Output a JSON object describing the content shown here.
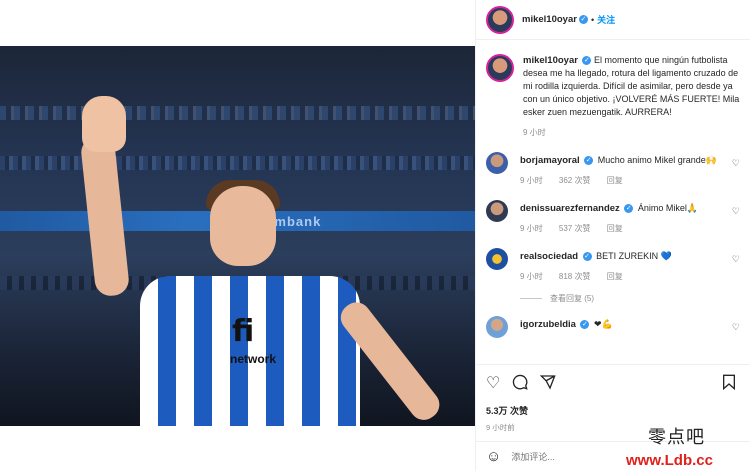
{
  "post": {
    "username": "mikel10oyar",
    "follow_label": "关注",
    "dot": "•",
    "caption": "El momento que ningún futbolista desea me ha llegado, rotura del ligamento cruzado de mi rodilla izquierda. Difícil de asimilar, pero desde ya con un único objetivo. ¡VOLVERÉ MÁS FUERTE! Mila esker zuen mezuengatik. AURRERA!",
    "caption_time": "9 小时",
    "media": {
      "sponsor": "fi",
      "sponsor_sub": "network",
      "ad_text": "Teambank"
    }
  },
  "comments": [
    {
      "username": "borjamayoral",
      "text": "Mucho animo Mikel grande🙌",
      "time": "9 小时",
      "likes": "362 次赞",
      "reply": "回复"
    },
    {
      "username": "denissuarezfernandez",
      "text": "Ánimo Mikel🙏",
      "time": "9 小时",
      "likes": "537 次赞",
      "reply": "回复"
    },
    {
      "username": "realsociedad",
      "text": "BETI ZUREKIN 💙",
      "time": "9 小时",
      "likes": "818 次赞",
      "reply": "回复",
      "view_replies": "查看回复 (5)"
    },
    {
      "username": "igorzubeldia",
      "text": "❤💪",
      "time": "",
      "likes": "",
      "reply": ""
    }
  ],
  "actions": {
    "likes_count": "5.3万 次赞",
    "time_ago": "9 小时前",
    "add_comment_placeholder": "添加评论..."
  },
  "watermark": {
    "chinese": "零点吧",
    "url": "www.Ldb.cc"
  },
  "icons": [
    "verified-icon",
    "heart-icon",
    "comment-icon",
    "share-icon",
    "bookmark-icon",
    "emoji-icon"
  ],
  "colors": {
    "link": "#0095f6",
    "verified": "#3897f0",
    "watermark_red": "#e0201b"
  }
}
